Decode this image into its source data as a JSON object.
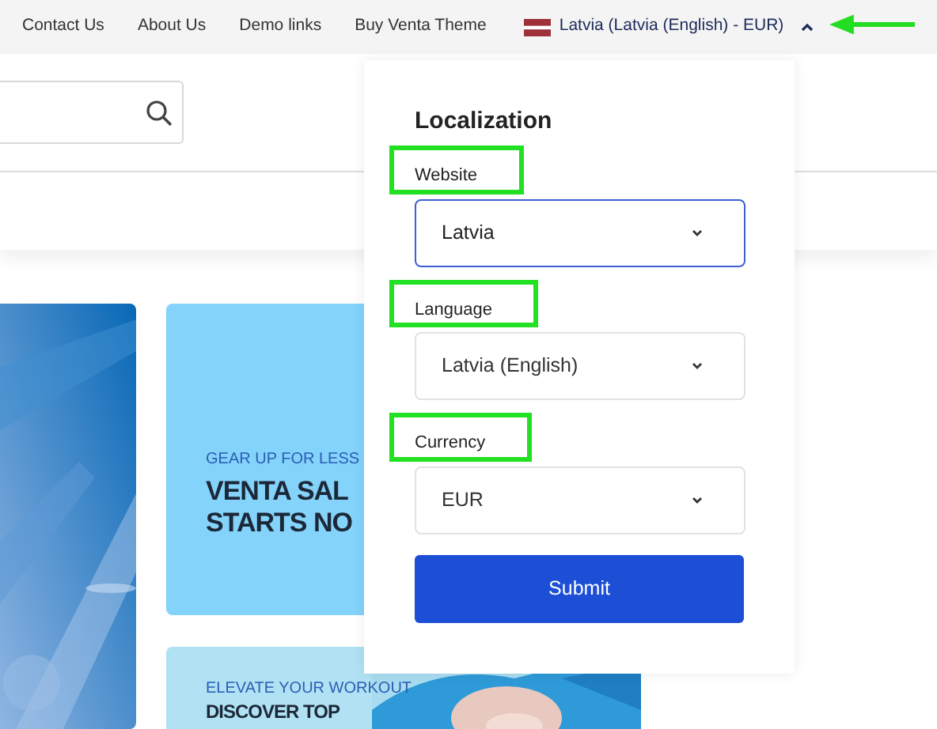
{
  "top_links": [
    "Contact Us",
    "About Us",
    "Demo links",
    "Buy Venta Theme"
  ],
  "locale_selector": {
    "label": "Latvia (Latvia (English) - EUR)",
    "expanded": true,
    "annotated": true
  },
  "banners": [
    {
      "kind": "picture"
    },
    {
      "kind": "promo",
      "eyebrow": "GEAR UP FOR LESS",
      "headline": [
        "VENTA SAL",
        "STARTS NO"
      ]
    },
    {
      "kind": "promo_photo",
      "eyebrow": "ELEVATE YOUR WORKOUT",
      "headline": [
        "DISCOVER TOP"
      ]
    }
  ],
  "localization": {
    "title": "Localization",
    "fields": [
      {
        "label": "Website",
        "value": "Latvia",
        "focused": true,
        "annotated": true
      },
      {
        "label": "Language",
        "value": "Latvia (English)",
        "focused": false,
        "annotated": true
      },
      {
        "label": "Currency",
        "value": "EUR",
        "focused": false,
        "annotated": true
      }
    ],
    "submit": "Submit"
  }
}
